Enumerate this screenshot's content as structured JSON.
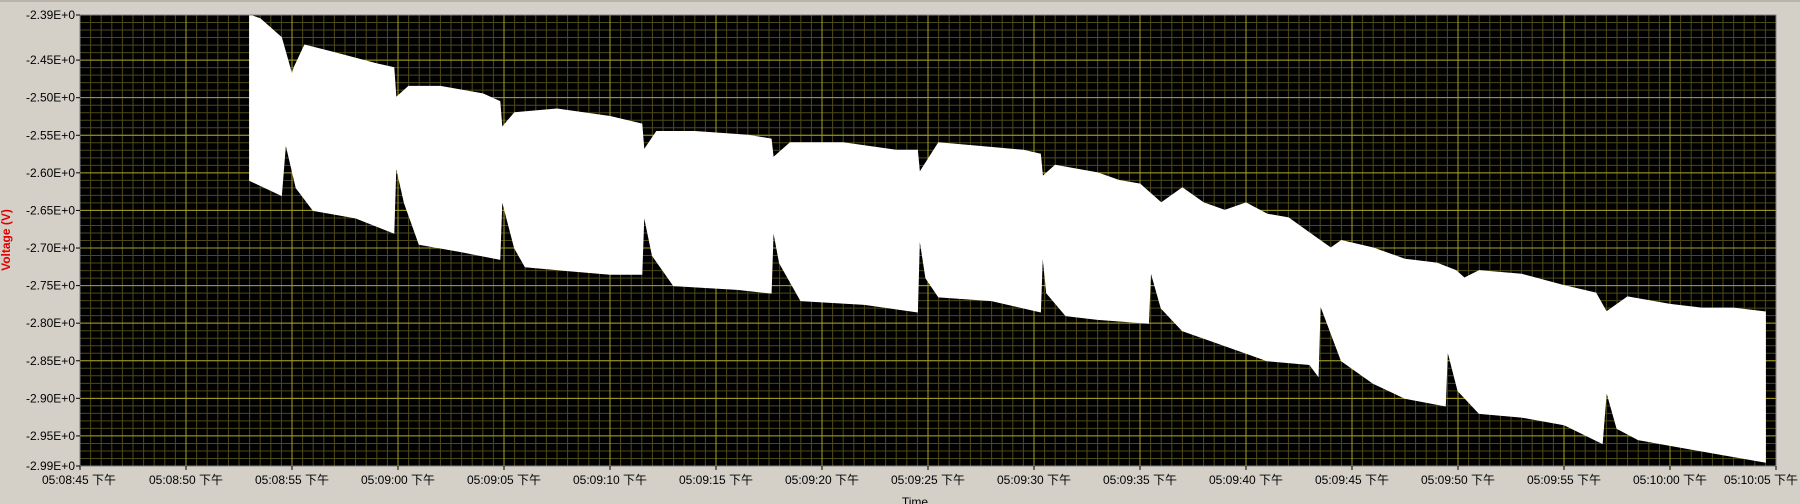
{
  "chart_data": {
    "type": "area",
    "ylabel": "Voltage (V)",
    "xlabel": "Time",
    "ylim": [
      -2.99,
      -2.39
    ],
    "xlim": [
      0,
      80
    ],
    "y_ticks": [
      "-2.39E+0",
      "-2.45E+0",
      "-2.50E+0",
      "-2.55E+0",
      "-2.60E+0",
      "-2.65E+0",
      "-2.70E+0",
      "-2.75E+0",
      "-2.80E+0",
      "-2.85E+0",
      "-2.90E+0",
      "-2.95E+0",
      "-2.99E+0"
    ],
    "y_tick_values": [
      -2.39,
      -2.45,
      -2.5,
      -2.55,
      -2.6,
      -2.65,
      -2.7,
      -2.75,
      -2.8,
      -2.85,
      -2.9,
      -2.95,
      -2.99
    ],
    "x_ticks": [
      "05:08:45 下午",
      "05:08:50 下午",
      "05:08:55 下午",
      "05:09:00 下午",
      "05:09:05 下午",
      "05:09:10 下午",
      "05:09:15 下午",
      "05:09:20 下午",
      "05:09:25 下午",
      "05:09:30 下午",
      "05:09:35 下午",
      "05:09:40 下午",
      "05:09:45 下午",
      "05:09:50 下午",
      "05:09:55 下午",
      "05:10:00 下午",
      "05:10:05 下午"
    ],
    "x_tick_values": [
      0,
      5,
      10,
      15,
      20,
      25,
      30,
      35,
      40,
      45,
      50,
      55,
      60,
      65,
      70,
      75,
      80
    ],
    "grid": true,
    "colors": {
      "plot_bg": "#000000",
      "grid_major": "#a8a020",
      "grid_minor": "#4e4a18",
      "series": "#ffffff",
      "ylabel": "#e00000",
      "frame": "#d4d0c8"
    },
    "series": [
      {
        "upper_x": [
          8.0,
          8.5,
          9.5,
          10.0,
          10.1,
          10.6,
          12.0,
          14.0,
          14.8,
          14.9,
          15.5,
          17.0,
          19.0,
          19.8,
          19.9,
          20.5,
          22.5,
          25.0,
          26.5,
          26.6,
          27.2,
          29.0,
          31.5,
          32.6,
          32.7,
          33.5,
          36.0,
          38.5,
          39.5,
          39.6,
          40.5,
          42.5,
          44.5,
          45.3,
          45.4,
          46.0,
          48.0,
          49.0,
          50.0,
          51.0,
          52.0,
          53.0,
          54.0,
          55.0,
          56.0,
          57.0,
          58.0,
          59.0,
          59.5,
          61.0,
          62.5,
          64.0,
          64.9,
          65.3,
          66.0,
          68.0,
          70.0,
          71.5,
          72.0,
          73.0,
          74.0,
          75.0,
          76.5,
          78.0,
          79.5
        ],
        "upper_y": [
          -2.39,
          -2.395,
          -2.42,
          -2.47,
          -2.46,
          -2.43,
          -2.44,
          -2.455,
          -2.46,
          -2.5,
          -2.485,
          -2.485,
          -2.495,
          -2.505,
          -2.54,
          -2.52,
          -2.515,
          -2.525,
          -2.535,
          -2.57,
          -2.545,
          -2.545,
          -2.55,
          -2.555,
          -2.58,
          -2.56,
          -2.56,
          -2.57,
          -2.57,
          -2.6,
          -2.56,
          -2.565,
          -2.57,
          -2.575,
          -2.605,
          -2.59,
          -2.6,
          -2.61,
          -2.615,
          -2.64,
          -2.62,
          -2.64,
          -2.65,
          -2.64,
          -2.655,
          -2.66,
          -2.68,
          -2.7,
          -2.69,
          -2.7,
          -2.715,
          -2.72,
          -2.73,
          -2.74,
          -2.73,
          -2.735,
          -2.75,
          -2.76,
          -2.785,
          -2.765,
          -2.77,
          -2.775,
          -2.78,
          -2.78,
          -2.785
        ],
        "lower_x": [
          8.0,
          9.5,
          9.7,
          10.2,
          11.0,
          13.0,
          14.8,
          14.9,
          15.3,
          16.0,
          18.0,
          19.8,
          19.9,
          20.5,
          21.0,
          23.0,
          25.0,
          26.5,
          26.6,
          27.0,
          28.0,
          31.0,
          32.6,
          32.7,
          33.0,
          34.0,
          37.0,
          39.5,
          39.6,
          39.9,
          40.5,
          43.0,
          45.3,
          45.4,
          45.6,
          46.5,
          48.0,
          50.4,
          50.5,
          51.0,
          52.0,
          54.0,
          56.0,
          58.0,
          58.4,
          58.5,
          59.5,
          61.0,
          62.5,
          64.4,
          64.5,
          65.0,
          66.0,
          68.0,
          70.0,
          71.8,
          72.0,
          72.5,
          73.5,
          75.5,
          77.5,
          79.5
        ],
        "lower_y": [
          -2.61,
          -2.63,
          -2.56,
          -2.62,
          -2.65,
          -2.66,
          -2.68,
          -2.59,
          -2.64,
          -2.695,
          -2.705,
          -2.715,
          -2.635,
          -2.7,
          -2.725,
          -2.73,
          -2.735,
          -2.735,
          -2.655,
          -2.71,
          -2.75,
          -2.755,
          -2.76,
          -2.675,
          -2.72,
          -2.77,
          -2.775,
          -2.785,
          -2.685,
          -2.74,
          -2.765,
          -2.77,
          -2.785,
          -2.705,
          -2.76,
          -2.79,
          -2.795,
          -2.8,
          -2.73,
          -2.78,
          -2.81,
          -2.83,
          -2.85,
          -2.855,
          -2.87,
          -2.775,
          -2.85,
          -2.88,
          -2.9,
          -2.91,
          -2.835,
          -2.89,
          -2.92,
          -2.925,
          -2.935,
          -2.96,
          -2.89,
          -2.94,
          -2.955,
          -2.965,
          -2.975,
          -2.985
        ],
        "spike_x": [
          9.7,
          14.9,
          19.9,
          26.6,
          32.7,
          39.6,
          45.4,
          50.5,
          58.5,
          64.5,
          72.0
        ],
        "spike_y": [
          -2.56,
          -2.59,
          -2.635,
          -2.655,
          -2.675,
          -2.685,
          -2.705,
          -2.73,
          -2.775,
          -2.835,
          -2.89
        ]
      }
    ]
  }
}
